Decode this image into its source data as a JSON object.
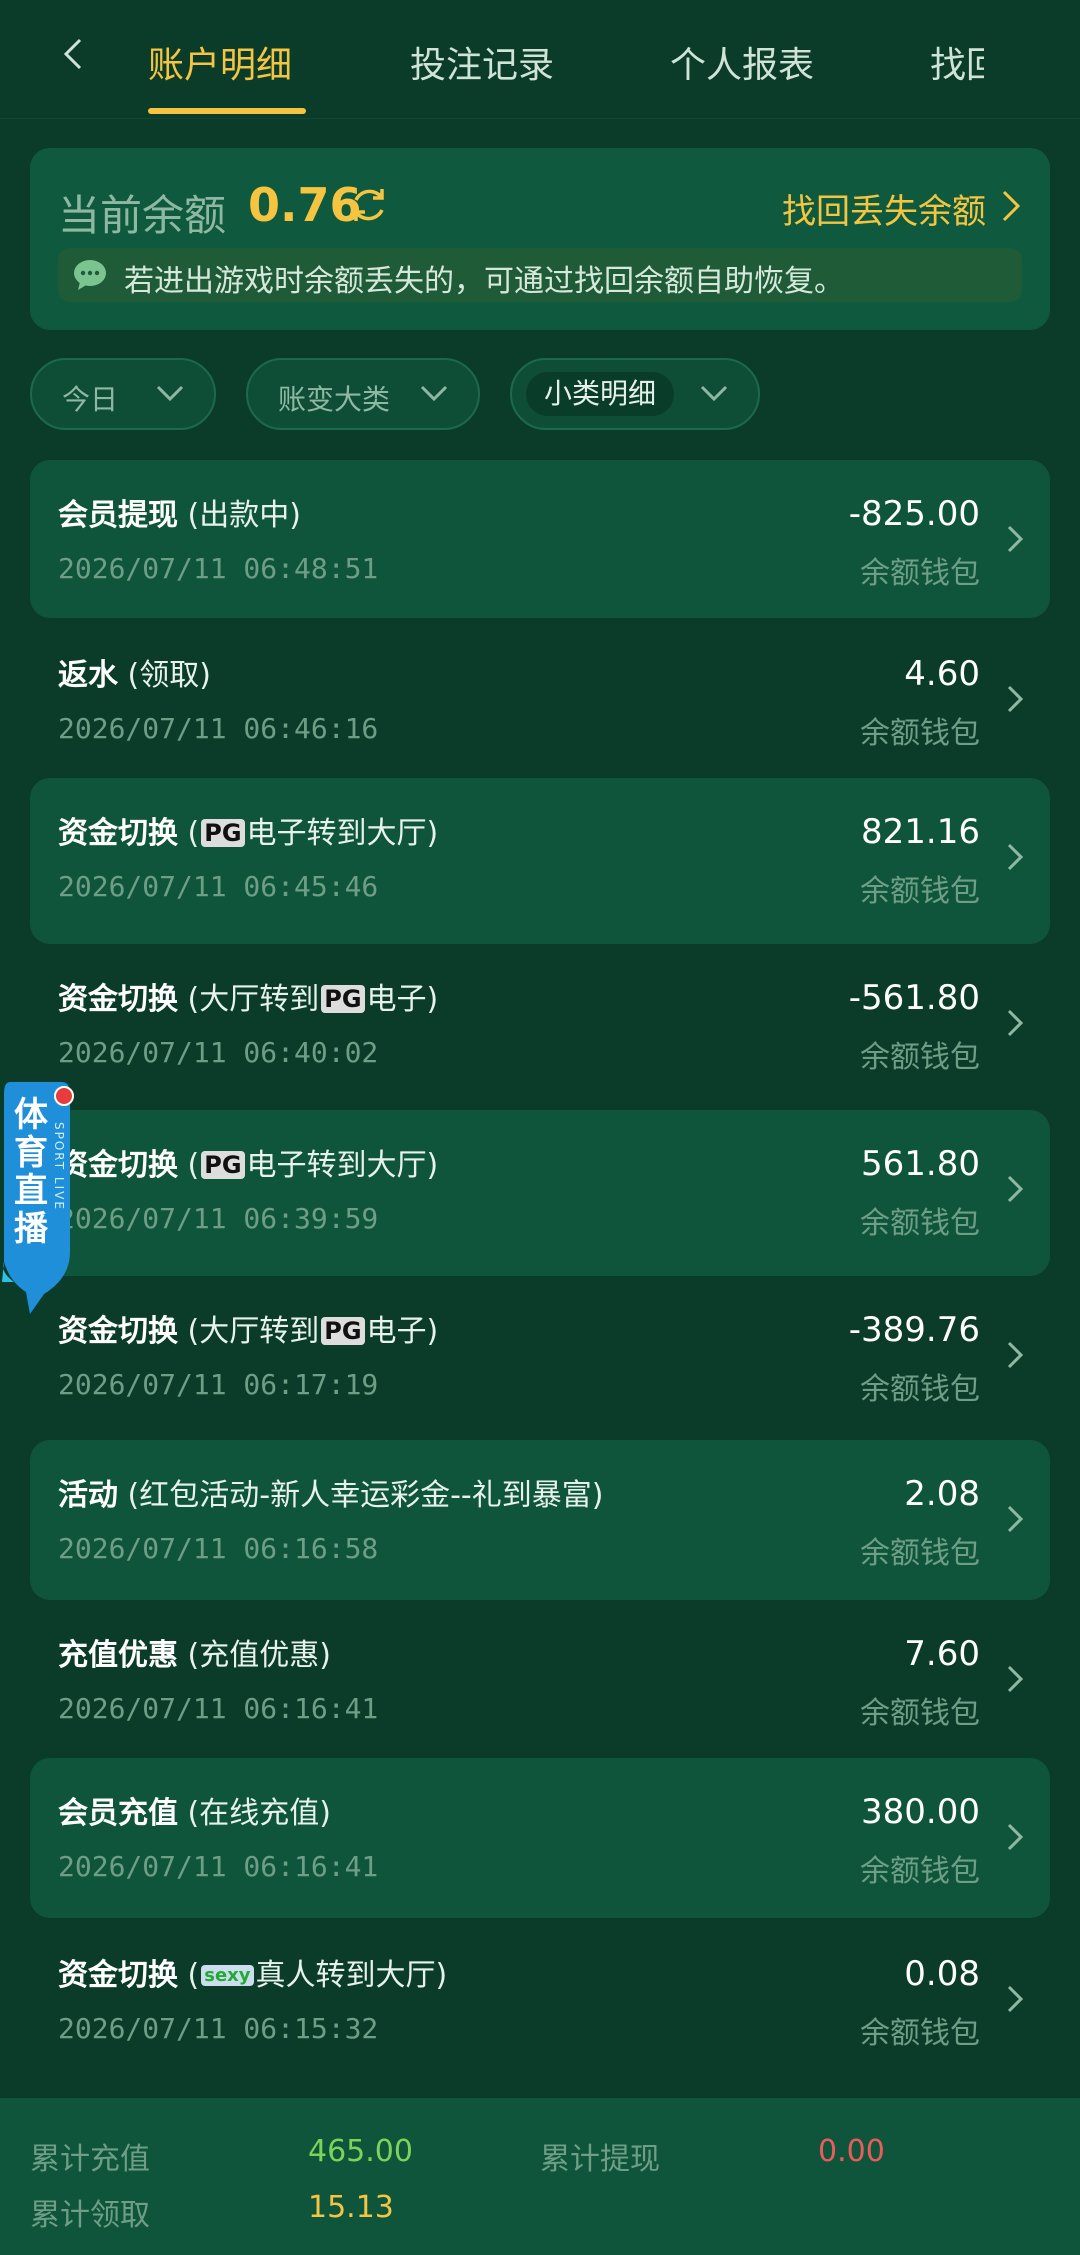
{
  "tabs": [
    "账户明细",
    "投注记录",
    "个人报表",
    "找回"
  ],
  "balance": {
    "label": "当前余额",
    "value": "0.76",
    "recover_label": "找回丢失余额",
    "notice": "若进出游戏时余额丢失的，可通过找回余额自助恢复。"
  },
  "filters": [
    {
      "label": "今日"
    },
    {
      "label": "账变大类"
    },
    {
      "label": "小类明细"
    }
  ],
  "records": [
    {
      "title": "会员提现",
      "pre": " (出款中)",
      "logo": "",
      "post": "",
      "time": "2026/07/11 06:48:51",
      "amount": "-825.00",
      "wallet": "余额钱包"
    },
    {
      "title": "返水",
      "pre": " (领取)",
      "logo": "",
      "post": "",
      "time": "2026/07/11 06:46:16",
      "amount": "4.60",
      "wallet": "余额钱包"
    },
    {
      "title": "资金切换",
      "pre": " (",
      "logo": "PG",
      "post": "电子转到大厅)",
      "time": "2026/07/11 06:45:46",
      "amount": "821.16",
      "wallet": "余额钱包"
    },
    {
      "title": "资金切换",
      "pre": " (大厅转到",
      "logo": "PG",
      "post": "电子)",
      "time": "2026/07/11 06:40:02",
      "amount": "-561.80",
      "wallet": "余额钱包"
    },
    {
      "title": "资金切换",
      "pre": " (",
      "logo": "PG",
      "post": "电子转到大厅)",
      "time": "2026/07/11 06:39:59",
      "amount": "561.80",
      "wallet": "余额钱包"
    },
    {
      "title": "资金切换",
      "pre": " (大厅转到",
      "logo": "PG",
      "post": "电子)",
      "time": "2026/07/11 06:17:19",
      "amount": "-389.76",
      "wallet": "余额钱包"
    },
    {
      "title": "活动",
      "pre": " (红包活动-新人幸运彩金--礼到暴富)",
      "logo": "",
      "post": "",
      "time": "2026/07/11 06:16:58",
      "amount": "2.08",
      "wallet": "余额钱包"
    },
    {
      "title": "充值优惠",
      "pre": " (充值优惠)",
      "logo": "",
      "post": "",
      "time": "2026/07/11 06:16:41",
      "amount": "7.60",
      "wallet": "余额钱包"
    },
    {
      "title": "会员充值",
      "pre": " (在线充值)",
      "logo": "",
      "post": "",
      "time": "2026/07/11 06:16:41",
      "amount": "380.00",
      "wallet": "余额钱包"
    },
    {
      "title": "资金切换",
      "pre": " (",
      "logo": "sexy",
      "post": "真人转到大厅)",
      "time": "2026/07/11 06:15:32",
      "amount": "0.08",
      "wallet": "余额钱包"
    }
  ],
  "live_badge": {
    "text": "体育直播",
    "sub": "SPORT LIVE"
  },
  "footer": {
    "recharge_label": "累计充值",
    "recharge_value": "465.00",
    "withdraw_label": "累计提现",
    "withdraw_value": "0.00",
    "claim_label": "累计领取",
    "claim_value": "15.13"
  },
  "colors": {
    "accent": "#f5c542",
    "positive": "#7bd35a",
    "negative": "#e85c5c",
    "bg": "#0b3c2a"
  }
}
